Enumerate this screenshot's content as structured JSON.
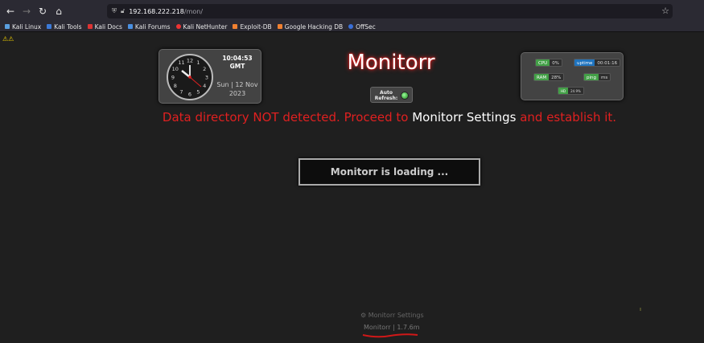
{
  "browser": {
    "url_host": "192.168.222.218",
    "url_path": "/mon/",
    "bookmarks": [
      "Kali Linux",
      "Kali Tools",
      "Kali Docs",
      "Kali Forums",
      "Kali NetHunter",
      "Exploit-DB",
      "Google Hacking DB",
      "OffSec"
    ]
  },
  "clock": {
    "time": "10:04:53",
    "zone": "GMT",
    "date_line1": "Sun | 12 Nov",
    "date_line2": "2023",
    "numbers": [
      "12",
      "1",
      "2",
      "3",
      "4",
      "5",
      "6",
      "7",
      "8",
      "9",
      "10",
      "11"
    ]
  },
  "header": {
    "title": "Monitorr",
    "auto_refresh_label": "Auto Refresh:"
  },
  "stats": {
    "cpu_label": "CPU",
    "cpu_value": "0%",
    "uptime_label": "uptime",
    "uptime_value": "00:01:16",
    "ram_label": "RAM",
    "ram_value": "28%",
    "ping_label": "ping",
    "ping_value": "ms",
    "hd_label": "HD",
    "hd_value": "24.9%"
  },
  "message": {
    "before": "Data directory NOT detected. Proceed to ",
    "link": "Monitorr Settings",
    "after": " and establish it."
  },
  "loading_text": "Monitorr is loading ...",
  "footer": {
    "settings_label": "Monitorr Settings",
    "version_label": "Monitorr | 1.7.6m"
  },
  "colors": {
    "error": "#e02020",
    "title_glow": "#ff2a2a",
    "status_green": "#43a047",
    "status_blue": "#1e73be"
  }
}
